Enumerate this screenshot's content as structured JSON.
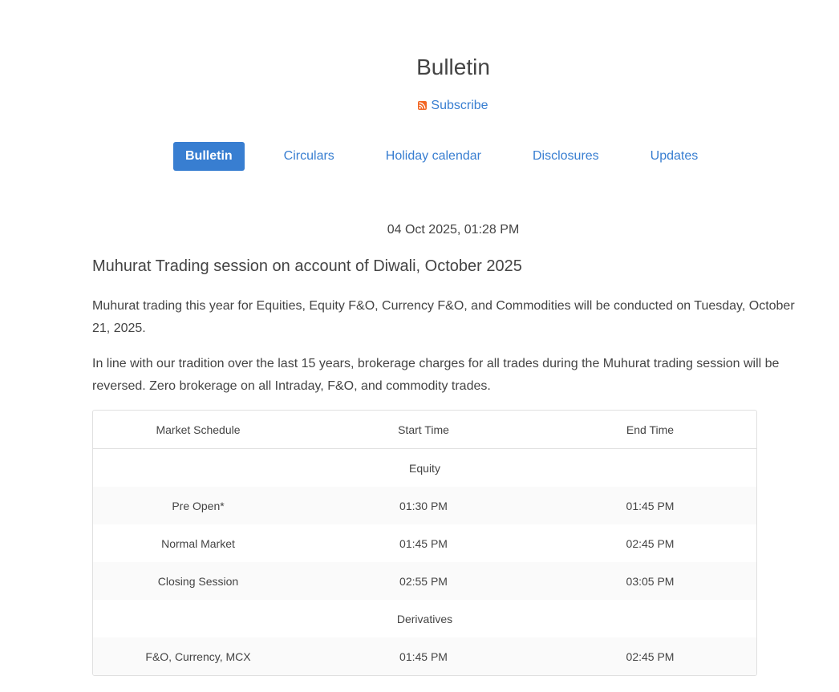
{
  "header": {
    "title": "Bulletin",
    "subscribe_label": "Subscribe"
  },
  "tabs": [
    {
      "label": "Bulletin",
      "active": true
    },
    {
      "label": "Circulars",
      "active": false
    },
    {
      "label": "Holiday calendar",
      "active": false
    },
    {
      "label": "Disclosures",
      "active": false
    },
    {
      "label": "Updates",
      "active": false
    }
  ],
  "post": {
    "date": "04 Oct 2025, 01:28 PM",
    "title": "Muhurat Trading session on account of Diwali, October 2025",
    "paragraphs": [
      "Muhurat trading this year for Equities, Equity F&O, Currency F&O, and Commodities will be conducted on Tuesday, October 21, 2025.",
      "In line with our tradition over the last 15 years, brokerage charges for all trades during the Muhurat trading session will be reversed. Zero brokerage on all Intraday, F&O, and commodity trades."
    ]
  },
  "schedule_table": {
    "headers": [
      "Market Schedule",
      "Start Time",
      "End Time"
    ],
    "sections": [
      {
        "name": "Equity",
        "rows": [
          [
            "Pre Open*",
            "01:30 PM",
            "01:45 PM"
          ],
          [
            "Normal Market",
            "01:45 PM",
            "02:45 PM"
          ],
          [
            "Closing Session",
            "02:55 PM",
            "03:05 PM"
          ]
        ]
      },
      {
        "name": "Derivatives",
        "rows": [
          [
            "F&O, Currency, MCX",
            "01:45 PM",
            "02:45 PM"
          ]
        ]
      }
    ]
  },
  "colors": {
    "accent": "#387ed1",
    "text": "#444444",
    "rss": "#f26522",
    "border": "#e0e0e0",
    "stripe": "#fafafa"
  }
}
